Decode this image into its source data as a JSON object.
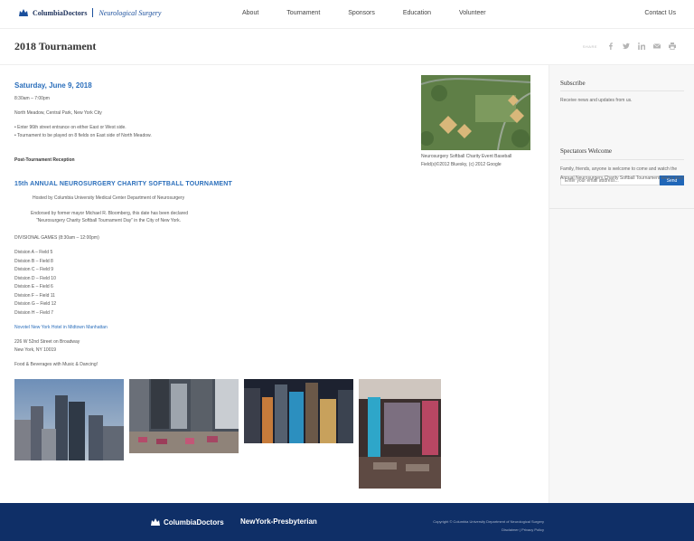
{
  "header": {
    "logo_main": "ColumbiaDoctors",
    "logo_sub": "Neurological Surgery",
    "nav": [
      "About",
      "Tournament",
      "Sponsors",
      "Education",
      "Volunteer"
    ],
    "contact": "Contact Us"
  },
  "titlebar": {
    "title": "2018 Tournament",
    "share_label": "SHARE"
  },
  "event": {
    "date": "Saturday, June 9, 2018",
    "time": "8:30am – 7:00pm",
    "location": "North Meadow, Central Park, New York City",
    "bullets": [
      "• Enter 96th street entrance on either East or West side.",
      "• Tournament to be played on 8 fields on East side of North Meadow."
    ],
    "reception": "Post-Tournament Reception",
    "heading": "15th ANNUAL NEUROSURGERY CHARITY SOFTBALL TOURNAMENT",
    "hosted": "Hosted by Columbia University Medical Center Department of Neurosurgery",
    "endorsed_1": "Endorsed by former mayor Michael R. Bloomberg, this date has been declared",
    "endorsed_2": "“Neurosurgery Charity Softball Tournament Day” in the City of New York.",
    "games_title": "DIVISIONAL GAMES (8:30am – 12:00pm)",
    "divisions": [
      "Division A – Field 5",
      "Division B – Field 8",
      "Division C – Field 9",
      "Division D – Field 10",
      "Division E – Field 6",
      "Division F – Field 11",
      "Division G – Field 12",
      "Division H – Field 7"
    ],
    "hotel_link": "Novotel New York Hotel in Midtown Manhattan",
    "address_1": "226 W 52nd Street on Broadway",
    "address_2": "New York, NY 10019",
    "food": "Food & Beverages with Music & Dancing!"
  },
  "map": {
    "caption_1": "Neurosurgery Softball Charity Event Baseball",
    "caption_2": "Field(s)©2012 Bluesky, (c) 2012 Google"
  },
  "sidebar": {
    "subscribe_title": "Subscribe",
    "subscribe_text": "Receive news and updates from us.",
    "email_placeholder": "Enter your email address...",
    "send_label": "Send",
    "welcome_title": "Spectators Welcome",
    "welcome_text": "Family, friends, anyone is welcome to come and watch the Annual Neurosurgery Charity Softball Tournament teams play!"
  },
  "footer": {
    "logo_1": "ColumbiaDoctors",
    "logo_2": "NewYork-Presbyterian",
    "copyright": "Copyright © Columbia University Department of Neurological Surgery",
    "links": "Disclaimer | Privacy Policy"
  },
  "icons": [
    "crown-icon",
    "facebook-icon",
    "twitter-icon",
    "linkedin-icon",
    "email-icon",
    "print-icon"
  ],
  "colors": {
    "accent": "#2a6ebb",
    "footer": "#0f2f67",
    "send": "#1f66b8"
  }
}
